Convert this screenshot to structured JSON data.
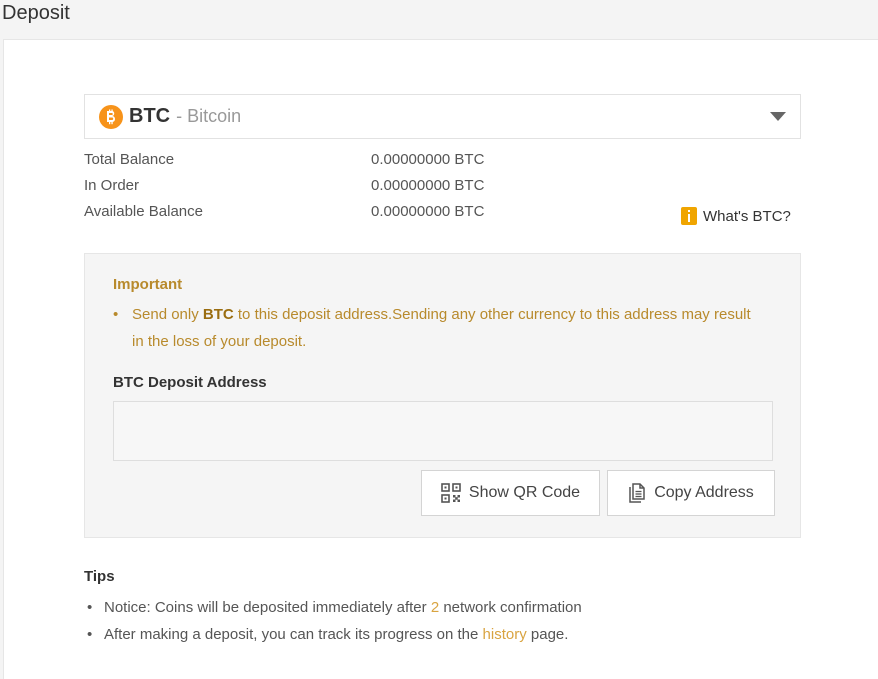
{
  "page": {
    "title": "Deposit"
  },
  "coin_select": {
    "symbol": "BTC",
    "separator": "-",
    "name": "Bitcoin",
    "icon": "bitcoin-icon",
    "icon_color": "#f7931a"
  },
  "balances": [
    {
      "label": "Total Balance",
      "value": "0.00000000 BTC"
    },
    {
      "label": "In Order",
      "value": "0.00000000 BTC"
    },
    {
      "label": "Available Balance",
      "value": "0.00000000 BTC"
    }
  ],
  "whats_link": {
    "label": "What's BTC?",
    "icon": "info-book-icon"
  },
  "important": {
    "title": "Important",
    "text_before": "Send only ",
    "coin": "BTC",
    "text_after": " to this deposit address.Sending any other currency to this address may result in the loss of your deposit."
  },
  "address": {
    "label": "BTC Deposit Address",
    "value": ""
  },
  "buttons": {
    "qr": {
      "label": "Show QR Code",
      "icon": "qr-code-icon"
    },
    "copy": {
      "label": "Copy Address",
      "icon": "copy-document-icon"
    }
  },
  "tips": {
    "title": "Tips",
    "tip1_before": "Notice: Coins will be deposited immediately after ",
    "tip1_count": "2",
    "tip1_after": " network confirmation",
    "tip2_before": "After making a deposit, you can track its progress on the ",
    "tip2_link": "history",
    "tip2_after": " page."
  },
  "colors": {
    "accent": "#d9a441",
    "important_text": "#b88a2c",
    "bitcoin_orange": "#f7931a"
  }
}
